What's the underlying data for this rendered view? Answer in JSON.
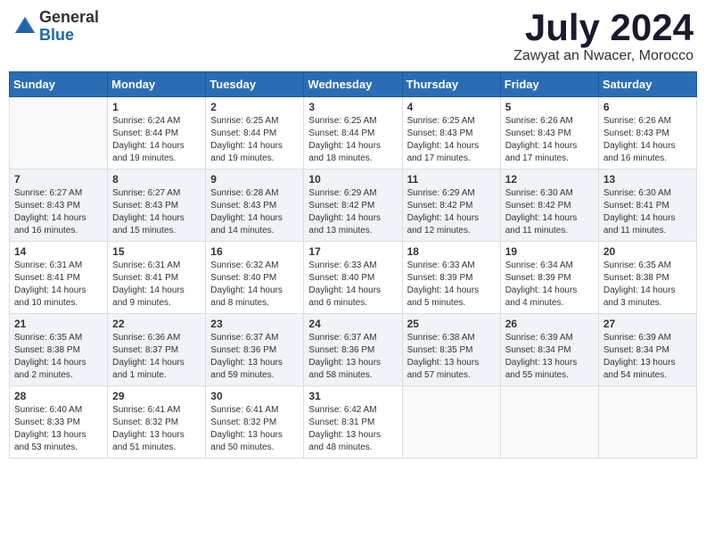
{
  "logo": {
    "general": "General",
    "blue": "Blue"
  },
  "title": "July 2024",
  "location": "Zawyat an Nwacer, Morocco",
  "days_header": [
    "Sunday",
    "Monday",
    "Tuesday",
    "Wednesday",
    "Thursday",
    "Friday",
    "Saturday"
  ],
  "weeks": [
    [
      {
        "num": "",
        "info": ""
      },
      {
        "num": "1",
        "info": "Sunrise: 6:24 AM\nSunset: 8:44 PM\nDaylight: 14 hours\nand 19 minutes."
      },
      {
        "num": "2",
        "info": "Sunrise: 6:25 AM\nSunset: 8:44 PM\nDaylight: 14 hours\nand 19 minutes."
      },
      {
        "num": "3",
        "info": "Sunrise: 6:25 AM\nSunset: 8:44 PM\nDaylight: 14 hours\nand 18 minutes."
      },
      {
        "num": "4",
        "info": "Sunrise: 6:25 AM\nSunset: 8:43 PM\nDaylight: 14 hours\nand 17 minutes."
      },
      {
        "num": "5",
        "info": "Sunrise: 6:26 AM\nSunset: 8:43 PM\nDaylight: 14 hours\nand 17 minutes."
      },
      {
        "num": "6",
        "info": "Sunrise: 6:26 AM\nSunset: 8:43 PM\nDaylight: 14 hours\nand 16 minutes."
      }
    ],
    [
      {
        "num": "7",
        "info": "Sunrise: 6:27 AM\nSunset: 8:43 PM\nDaylight: 14 hours\nand 16 minutes."
      },
      {
        "num": "8",
        "info": "Sunrise: 6:27 AM\nSunset: 8:43 PM\nDaylight: 14 hours\nand 15 minutes."
      },
      {
        "num": "9",
        "info": "Sunrise: 6:28 AM\nSunset: 8:43 PM\nDaylight: 14 hours\nand 14 minutes."
      },
      {
        "num": "10",
        "info": "Sunrise: 6:29 AM\nSunset: 8:42 PM\nDaylight: 14 hours\nand 13 minutes."
      },
      {
        "num": "11",
        "info": "Sunrise: 6:29 AM\nSunset: 8:42 PM\nDaylight: 14 hours\nand 12 minutes."
      },
      {
        "num": "12",
        "info": "Sunrise: 6:30 AM\nSunset: 8:42 PM\nDaylight: 14 hours\nand 11 minutes."
      },
      {
        "num": "13",
        "info": "Sunrise: 6:30 AM\nSunset: 8:41 PM\nDaylight: 14 hours\nand 11 minutes."
      }
    ],
    [
      {
        "num": "14",
        "info": "Sunrise: 6:31 AM\nSunset: 8:41 PM\nDaylight: 14 hours\nand 10 minutes."
      },
      {
        "num": "15",
        "info": "Sunrise: 6:31 AM\nSunset: 8:41 PM\nDaylight: 14 hours\nand 9 minutes."
      },
      {
        "num": "16",
        "info": "Sunrise: 6:32 AM\nSunset: 8:40 PM\nDaylight: 14 hours\nand 8 minutes."
      },
      {
        "num": "17",
        "info": "Sunrise: 6:33 AM\nSunset: 8:40 PM\nDaylight: 14 hours\nand 6 minutes."
      },
      {
        "num": "18",
        "info": "Sunrise: 6:33 AM\nSunset: 8:39 PM\nDaylight: 14 hours\nand 5 minutes."
      },
      {
        "num": "19",
        "info": "Sunrise: 6:34 AM\nSunset: 8:39 PM\nDaylight: 14 hours\nand 4 minutes."
      },
      {
        "num": "20",
        "info": "Sunrise: 6:35 AM\nSunset: 8:38 PM\nDaylight: 14 hours\nand 3 minutes."
      }
    ],
    [
      {
        "num": "21",
        "info": "Sunrise: 6:35 AM\nSunset: 8:38 PM\nDaylight: 14 hours\nand 2 minutes."
      },
      {
        "num": "22",
        "info": "Sunrise: 6:36 AM\nSunset: 8:37 PM\nDaylight: 14 hours\nand 1 minute."
      },
      {
        "num": "23",
        "info": "Sunrise: 6:37 AM\nSunset: 8:36 PM\nDaylight: 13 hours\nand 59 minutes."
      },
      {
        "num": "24",
        "info": "Sunrise: 6:37 AM\nSunset: 8:36 PM\nDaylight: 13 hours\nand 58 minutes."
      },
      {
        "num": "25",
        "info": "Sunrise: 6:38 AM\nSunset: 8:35 PM\nDaylight: 13 hours\nand 57 minutes."
      },
      {
        "num": "26",
        "info": "Sunrise: 6:39 AM\nSunset: 8:34 PM\nDaylight: 13 hours\nand 55 minutes."
      },
      {
        "num": "27",
        "info": "Sunrise: 6:39 AM\nSunset: 8:34 PM\nDaylight: 13 hours\nand 54 minutes."
      }
    ],
    [
      {
        "num": "28",
        "info": "Sunrise: 6:40 AM\nSunset: 8:33 PM\nDaylight: 13 hours\nand 53 minutes."
      },
      {
        "num": "29",
        "info": "Sunrise: 6:41 AM\nSunset: 8:32 PM\nDaylight: 13 hours\nand 51 minutes."
      },
      {
        "num": "30",
        "info": "Sunrise: 6:41 AM\nSunset: 8:32 PM\nDaylight: 13 hours\nand 50 minutes."
      },
      {
        "num": "31",
        "info": "Sunrise: 6:42 AM\nSunset: 8:31 PM\nDaylight: 13 hours\nand 48 minutes."
      },
      {
        "num": "",
        "info": ""
      },
      {
        "num": "",
        "info": ""
      },
      {
        "num": "",
        "info": ""
      }
    ]
  ]
}
